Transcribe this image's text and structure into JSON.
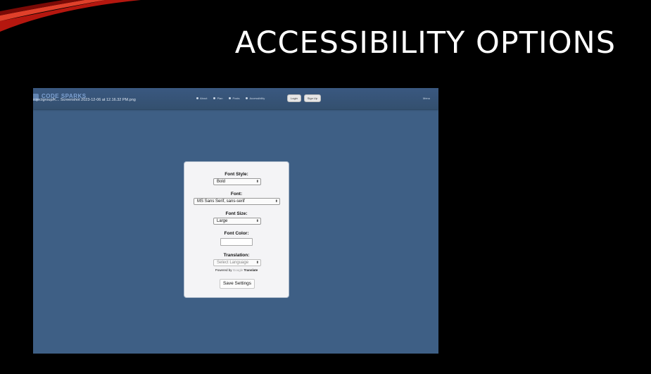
{
  "slide": {
    "title": "ACCESSIBILITY OPTIONS"
  },
  "screenshot": {
    "logo_text": "CODE SPARKS",
    "file_caption": "rojectgroup/K... Screenshot 2023-12-06 at 12.16.32 PM.png",
    "nav": {
      "items": [
        {
          "label": "About"
        },
        {
          "label": "Plan"
        },
        {
          "label": "Posts"
        },
        {
          "label": "Accessibility"
        }
      ]
    },
    "auth": {
      "login_label": "Login",
      "signup_label": "Sign Up"
    },
    "menu_label": "Menu",
    "settings": {
      "font_style_label": "Font Style:",
      "font_style_value": "Bold",
      "font_label": "Font:",
      "font_value": "MS Sans Serif, sans-serif",
      "font_size_label": "Font Size:",
      "font_size_value": "Large",
      "font_color_label": "Font Color:",
      "font_color_value": "#ffffff",
      "translation_label": "Translation:",
      "translation_placeholder": "Select Language",
      "powered_prefix": "Powered by",
      "powered_google": "Google",
      "powered_translate": "Translate",
      "save_label": "Save Settings"
    }
  },
  "colors": {
    "slide_background": "#000000",
    "app_background": "#3e5f85",
    "panel_background": "#f4f4f6"
  },
  "icons": {
    "chevron": "chevron-updown-icon"
  }
}
